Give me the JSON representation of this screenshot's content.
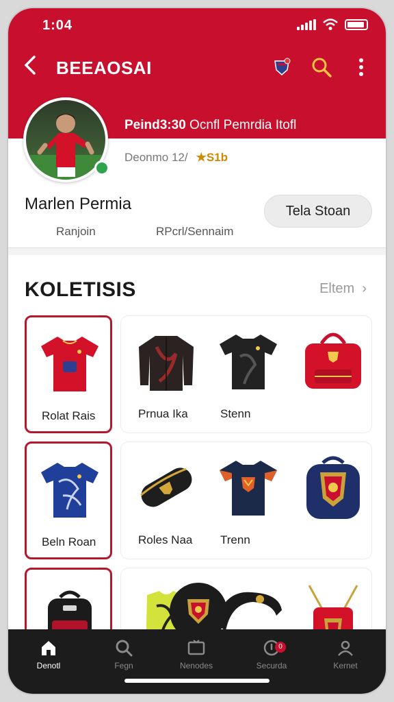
{
  "status_bar": {
    "time": "1:04"
  },
  "header": {
    "title": "BEEAOSAI",
    "back_icon": "back-chevron-icon",
    "colors": {
      "brand": "#c8102e"
    }
  },
  "profile": {
    "stat_strong": "Peind3:30",
    "stat_rest": "Ocnfl Pemrdia Itofl",
    "sub_text": "Deonmo 12/",
    "rating": "S1b",
    "name": "Marlen Permia",
    "meta_left": "Ranjoin",
    "meta_right": "RPcrl/Sennaim",
    "follow_label": "Tela Stoan"
  },
  "collection": {
    "title": "KOLETISIS",
    "see_all": "Eltem",
    "rows": [
      {
        "items": [
          {
            "label": "Rolat Rais",
            "kind": "red-jersey",
            "selected": true
          },
          {
            "label": "Prnua Ika",
            "kind": "jacket",
            "selected": false
          },
          {
            "label": "Stenn",
            "kind": "black-jersey",
            "selected": false
          },
          {
            "label": "",
            "kind": "red-bag",
            "selected": false
          }
        ]
      },
      {
        "items": [
          {
            "label": "Beln Roan",
            "kind": "blue-jersey",
            "selected": true
          },
          {
            "label": "Roles Naa",
            "kind": "pouch",
            "selected": false
          },
          {
            "label": "Trenn",
            "kind": "navy-jersey",
            "selected": false
          },
          {
            "label": "",
            "kind": "crest-backpack",
            "selected": false
          }
        ]
      },
      {
        "items": [
          {
            "label": "",
            "kind": "backpack",
            "selected": true
          },
          {
            "label": "",
            "kind": "yellow-vest",
            "selected": false
          },
          {
            "label": "",
            "kind": "scarf",
            "selected": false
          },
          {
            "label": "",
            "kind": "red-drawstring",
            "selected": false
          }
        ]
      }
    ]
  },
  "bottom_nav": [
    {
      "label": "Denotl",
      "icon": "home-icon",
      "active": true
    },
    {
      "label": "Fegn",
      "icon": "search-icon",
      "active": false
    },
    {
      "label": "Nenodes",
      "icon": "tv-icon",
      "active": false
    },
    {
      "label": "Securda",
      "icon": "bell-icon",
      "active": false,
      "badge": "0"
    },
    {
      "label": "Kernet",
      "icon": "profile-icon",
      "active": false
    }
  ]
}
